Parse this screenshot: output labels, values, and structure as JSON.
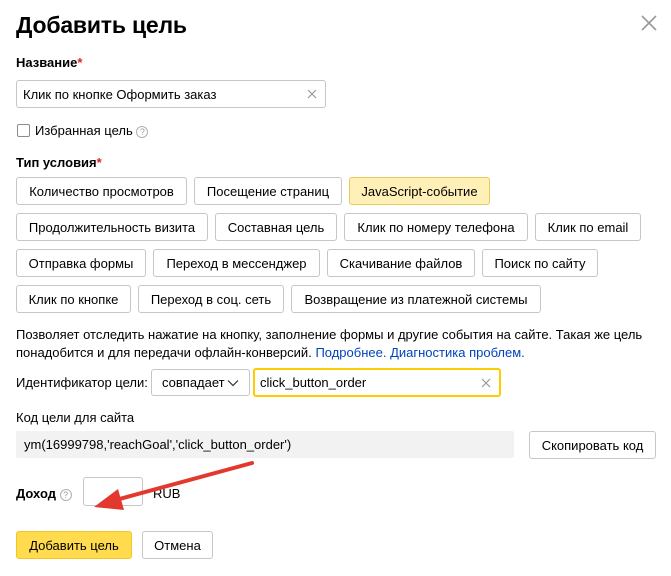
{
  "dialog": {
    "title": "Добавить цель"
  },
  "name_field": {
    "label": "Название",
    "required_mark": "*",
    "value": "Клик по кнопке Оформить заказ"
  },
  "favorite": {
    "label": "Избранная цель",
    "checked": false,
    "help": "?"
  },
  "condition": {
    "label": "Тип условия",
    "required_mark": "*",
    "selected": "JavaScript-событие",
    "options": [
      "Количество просмотров",
      "Посещение страниц",
      "JavaScript-событие",
      "Продолжительность визита",
      "Составная цель",
      "Клик по номеру телефона",
      "Клик по email",
      "Отправка формы",
      "Переход в мессенджер",
      "Скачивание файлов",
      "Поиск по сайту",
      "Клик по кнопке",
      "Переход в соц. сеть",
      "Возвращение из платежной системы"
    ]
  },
  "description": {
    "text": "Позволяет отследить нажатие на кнопку, заполнение формы и другие события на сайте. Такая же цель понадобится и для передачи офлайн-конверсий.",
    "link_more": "Подробнее.",
    "link_diag": "Диагностика проблем."
  },
  "identifier": {
    "label": "Идентификатор цели:",
    "match_select": "совпадает",
    "value": "click_button_order"
  },
  "goal_code": {
    "label": "Код цели для сайта",
    "code": "ym(16999798,'reachGoal','click_button_order')",
    "copy_button": "Скопировать код"
  },
  "income": {
    "label": "Доход",
    "help": "?",
    "value": "",
    "currency": "RUB"
  },
  "actions": {
    "submit": "Добавить цель",
    "cancel": "Отмена"
  },
  "colors": {
    "primary_button": "#ffdb4d",
    "selected_chip": "#fff0b8",
    "link": "#0044bb",
    "required": "#e51c23",
    "focus_border": "#ffcc00",
    "annotation_arrow": "#e2382e"
  }
}
